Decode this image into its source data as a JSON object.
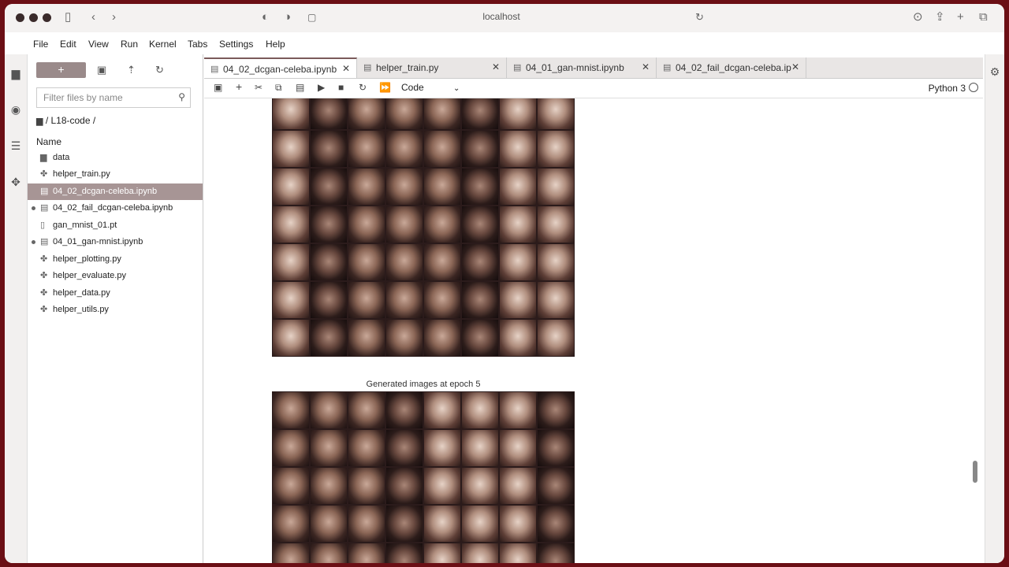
{
  "browser": {
    "address": "localhost",
    "icons": [
      "sidebar-icon",
      "back-icon",
      "forward-icon",
      "privacy-icon",
      "shield-icon",
      "page-icon",
      "reload-icon",
      "download-icon",
      "share-icon",
      "new-tab-icon",
      "tabs-overview-icon"
    ]
  },
  "menubar": {
    "items": [
      "File",
      "Edit",
      "View",
      "Run",
      "Kernel",
      "Tabs",
      "Settings",
      "Help"
    ]
  },
  "filebrowser": {
    "new_label": "+",
    "filter_placeholder": "Filter files by name",
    "breadcrumb": "/ L18-code /",
    "name_header": "Name",
    "files": [
      {
        "name": "data",
        "icon": "folder-icon",
        "selected": false,
        "running": false
      },
      {
        "name": "helper_train.py",
        "icon": "python-file-icon",
        "selected": false,
        "running": false
      },
      {
        "name": "04_02_dcgan-celeba.ipynb",
        "icon": "notebook-icon",
        "selected": true,
        "running": false
      },
      {
        "name": "04_02_fail_dcgan-celeba.ipynb",
        "icon": "notebook-icon",
        "selected": false,
        "running": true
      },
      {
        "name": "gan_mnist_01.pt",
        "icon": "file-icon",
        "selected": false,
        "running": false
      },
      {
        "name": "04_01_gan-mnist.ipynb",
        "icon": "notebook-icon",
        "selected": false,
        "running": true
      },
      {
        "name": "helper_plotting.py",
        "icon": "python-file-icon",
        "selected": false,
        "running": false
      },
      {
        "name": "helper_evaluate.py",
        "icon": "python-file-icon",
        "selected": false,
        "running": false
      },
      {
        "name": "helper_data.py",
        "icon": "python-file-icon",
        "selected": false,
        "running": false
      },
      {
        "name": "helper_utils.py",
        "icon": "python-file-icon",
        "selected": false,
        "running": false
      }
    ]
  },
  "tabs": [
    {
      "label": "04_02_dcgan-celeba.ipynb",
      "active": true
    },
    {
      "label": "helper_train.py",
      "active": false
    },
    {
      "label": "04_01_gan-mnist.ipynb",
      "active": false
    },
    {
      "label": "04_02_fail_dcgan-celeba.ip",
      "active": false
    }
  ],
  "notebook": {
    "cell_type": "Code",
    "kernel": "Python 3",
    "caption_epoch5": "Generated images at epoch 5"
  }
}
